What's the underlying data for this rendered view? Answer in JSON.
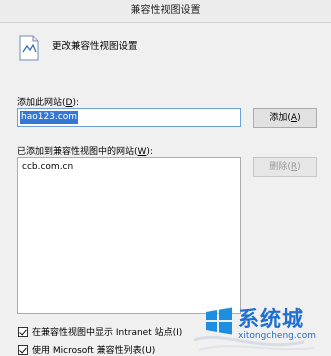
{
  "window": {
    "title": "兼容性视图设置"
  },
  "header": {
    "icon": "document-settings-icon",
    "text": "更改兼容性视图设置"
  },
  "add_section": {
    "label_pre": "添加此网站(",
    "label_key": "D",
    "label_post": "):",
    "input_value": "hao123.com",
    "add_button_pre": "添加(",
    "add_button_key": "A",
    "add_button_post": ")"
  },
  "list_section": {
    "label_pre": "已添加到兼容性视图中的网站(",
    "label_key": "W",
    "label_post": "):",
    "items": [
      "ccb.com.cn"
    ],
    "remove_button_pre": "删除(",
    "remove_button_key": "R",
    "remove_button_post": ")"
  },
  "options": [
    {
      "label": "在兼容性视图中显示 Intranet 站点(I)",
      "checked": true
    },
    {
      "label": "使用 Microsoft 兼容性列表(U)",
      "checked": true
    }
  ],
  "watermark": {
    "brand": "系统城",
    "url": "xitongcheng.com",
    "icon": "windows-logo-icon",
    "brand_color": "#1e6fd0"
  }
}
